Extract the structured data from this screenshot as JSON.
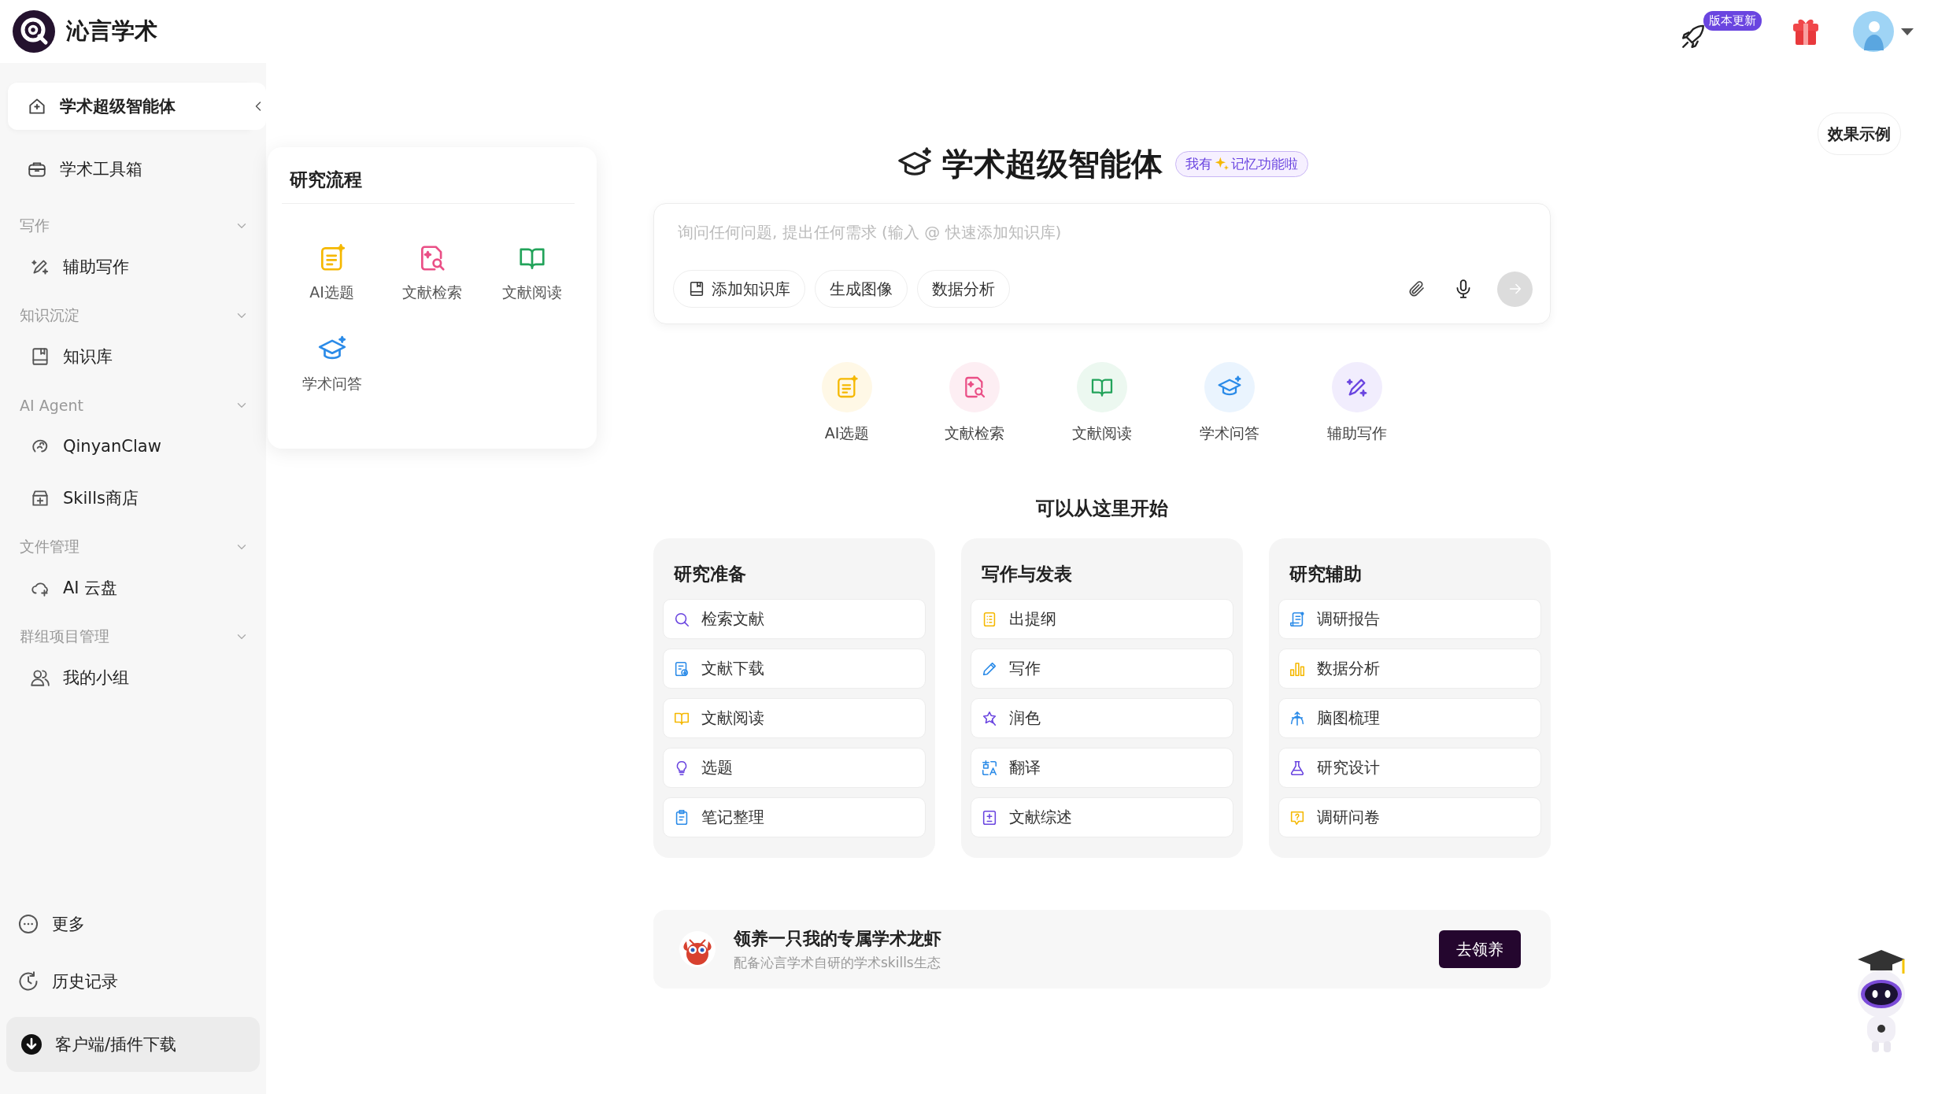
{
  "header": {
    "brand": "沁言学术",
    "update_badge": "版本更新"
  },
  "sidebar": {
    "items": [
      {
        "kind": "link",
        "label": "学术超级智能体",
        "selected": true
      },
      {
        "kind": "link",
        "label": "学术工具箱",
        "selected": false
      },
      {
        "kind": "section",
        "label": "写作",
        "expanded": true,
        "children": [
          {
            "label": "辅助写作",
            "selected": false
          }
        ]
      },
      {
        "kind": "section",
        "label": "知识沉淀",
        "expanded": true,
        "children": [
          {
            "label": "知识库",
            "selected": false
          }
        ]
      },
      {
        "kind": "section",
        "label": "AI Agent",
        "expanded": true,
        "children": [
          {
            "label": "QinyanClaw",
            "selected": false
          },
          {
            "label": "Skills商店",
            "selected": false
          }
        ]
      },
      {
        "kind": "section",
        "label": "文件管理",
        "expanded": true,
        "children": [
          {
            "label": "AI 云盘",
            "selected": false
          }
        ]
      },
      {
        "kind": "section",
        "label": "群组项目管理",
        "expanded": true,
        "children": [
          {
            "label": "我的小组",
            "selected": false
          }
        ]
      }
    ],
    "footer_items": [
      {
        "kind": "link",
        "label": "更多"
      },
      {
        "kind": "link",
        "label": "历史记录"
      },
      {
        "kind": "button",
        "label": "客户端/插件下载"
      }
    ]
  },
  "popup": {
    "title": "研究流程",
    "items": [
      "AI选题",
      "文献检索",
      "文献阅读",
      "学术问答"
    ]
  },
  "effect_button": "效果示例",
  "main": {
    "title": "学术超级智能体",
    "memory_badge": {
      "text_1": "我有",
      "text_2": "记忆功能啦"
    },
    "search": {
      "placeholder": "询问任何问题, 提出任何需求 (输入 @ 快速添加知识库)",
      "chips": [
        "添加知识库",
        "生成图像",
        "数据分析"
      ],
      "send_disabled": true
    },
    "quick_tools": [
      "AI选题",
      "文献检索",
      "文献阅读",
      "学术问答",
      "辅助写作"
    ],
    "start_title": "可以从这里开始",
    "categories": [
      {
        "title": "研究准备",
        "items": [
          "检索文献",
          "文献下载",
          "文献阅读",
          "选题",
          "笔记整理"
        ]
      },
      {
        "title": "写作与发表",
        "items": [
          "出提纲",
          "写作",
          "润色",
          "翻译",
          "文献综述"
        ]
      },
      {
        "title": "研究辅助",
        "items": [
          "调研报告",
          "数据分析",
          "脑图梳理",
          "研究设计",
          "调研问卷"
        ]
      }
    ],
    "banner": {
      "title": "领养一只我的专属学术龙虾",
      "subtitle": "配备沁言学术自研的学术skills生态",
      "button": "去领养"
    }
  }
}
